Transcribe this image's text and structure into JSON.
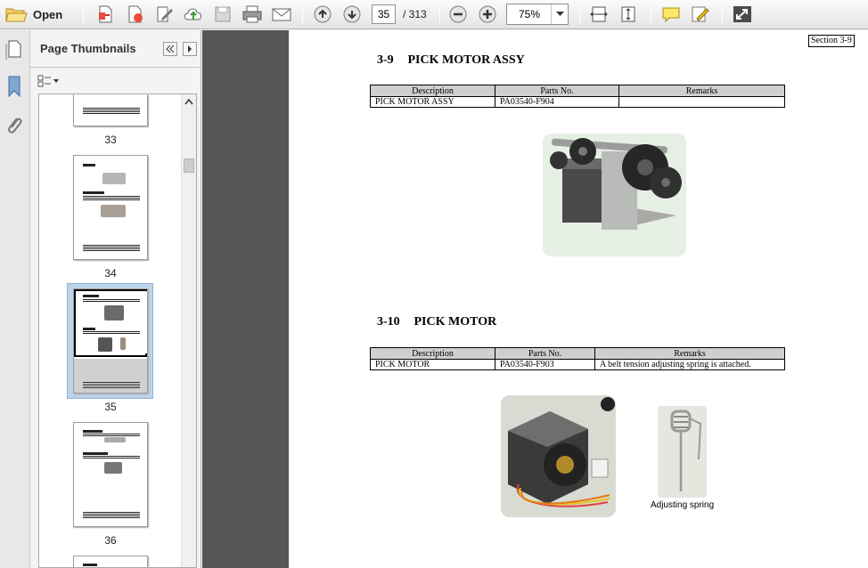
{
  "toolbar": {
    "open_label": "Open",
    "page_current": "35",
    "page_total": "/ 313",
    "zoom": "75%"
  },
  "thumbnails": {
    "title": "Page Thumbnails",
    "pages": [
      "33",
      "34",
      "35",
      "36"
    ]
  },
  "document": {
    "section_tag": "Section 3-9",
    "sections": [
      {
        "number": "3-9",
        "title": "PICK MOTOR ASSY",
        "headers": [
          "Description",
          "Parts No.",
          "Remarks"
        ],
        "rows": [
          [
            "PICK MOTOR ASSY",
            "PA03540-F904",
            ""
          ]
        ]
      },
      {
        "number": "3-10",
        "title": "PICK MOTOR",
        "headers": [
          "Description",
          "Parts No.",
          "Remarks"
        ],
        "rows": [
          [
            "PICK MOTOR",
            "PA03540-F903",
            "A belt tension adjusting spring is attached."
          ]
        ]
      }
    ],
    "spring_caption": "Adjusting spring"
  },
  "colors": {
    "selection": "#bcd4ea",
    "doc_background": "#555555",
    "table_header": "#cfcfcf"
  },
  "icons": [
    "open-folder-icon",
    "create-pdf-icon",
    "edit-pdf-icon",
    "sign-icon",
    "upload-icon",
    "save-icon",
    "print-icon",
    "email-icon",
    "previous-page-icon",
    "next-page-icon",
    "zoom-out-icon",
    "zoom-in-icon",
    "fit-width-icon",
    "fit-page-icon",
    "comment-icon",
    "highlight-icon",
    "full-screen-icon",
    "page-thumbnails-icon",
    "bookmarks-icon",
    "attachments-icon"
  ]
}
